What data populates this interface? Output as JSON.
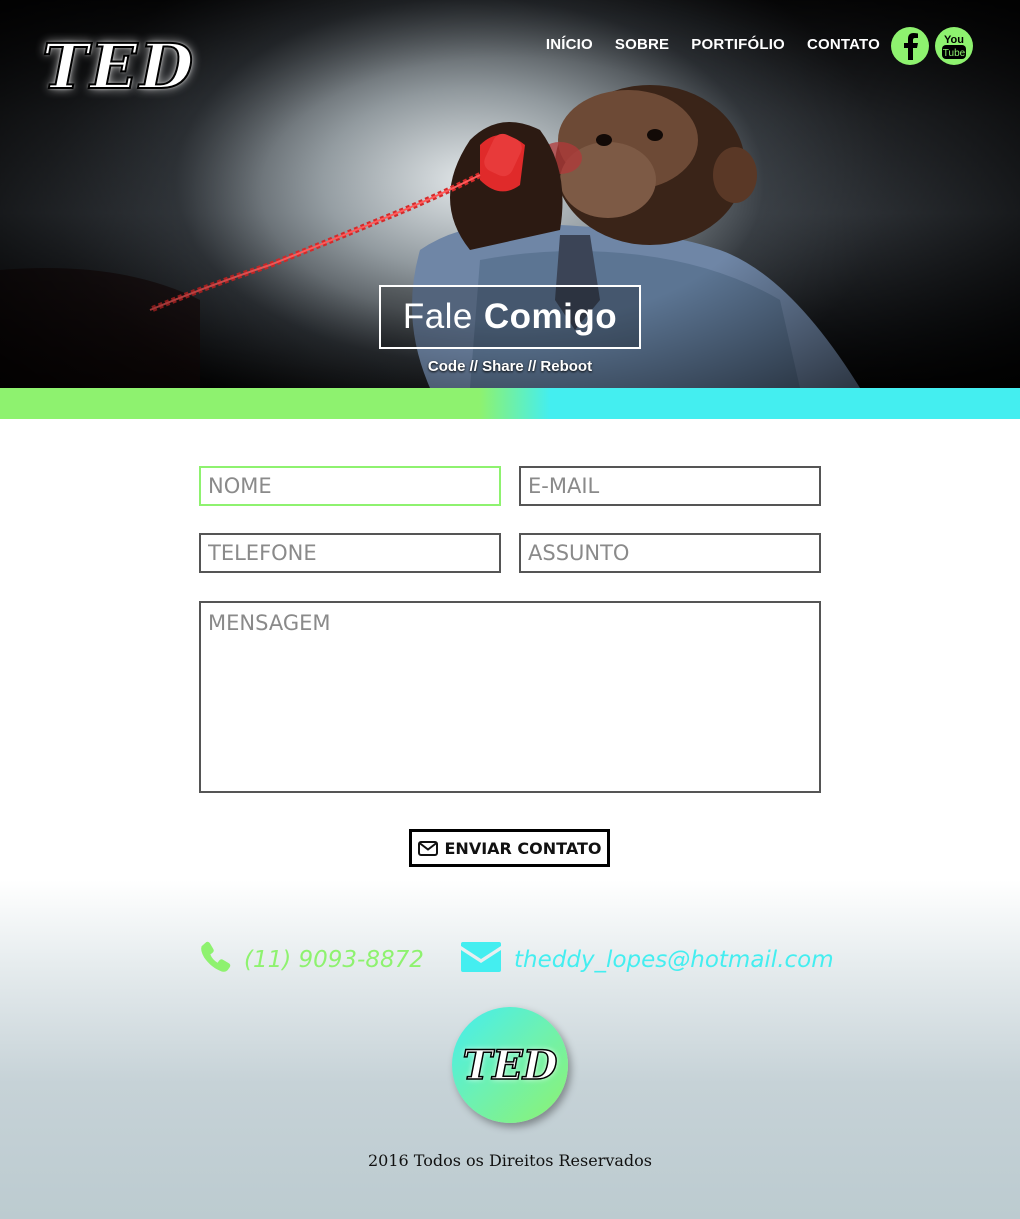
{
  "brand": {
    "logo_text": "TED"
  },
  "nav": {
    "items": [
      {
        "label": "INÍCIO"
      },
      {
        "label": "SOBRE"
      },
      {
        "label": "PORTIFÓLIO"
      },
      {
        "label": "CONTATO"
      }
    ]
  },
  "social": {
    "facebook_icon": "facebook-icon",
    "youtube_icon": "youtube-icon",
    "youtube_text_top": "You",
    "youtube_text_bottom": "Tube"
  },
  "hero": {
    "title_part1": "Fale",
    "title_part2": "Comigo",
    "subtitle": "Code // Share // Reboot"
  },
  "form": {
    "nome_placeholder": "NOME",
    "email_placeholder": "E-MAIL",
    "telefone_placeholder": "TELEFONE",
    "assunto_placeholder": "ASSUNTO",
    "mensagem_placeholder": "MENSAGEM",
    "submit_label": "ENVIAR CONTATO"
  },
  "contact": {
    "phone": "(11) 9093-8872",
    "email": "theddy_lopes@hotmail.com"
  },
  "footer": {
    "logo_text": "TED",
    "copyright": "2016 Todos os Direitos Reservados"
  },
  "colors": {
    "accent_green": "#8ef26f",
    "accent_cyan": "#44eef0"
  }
}
